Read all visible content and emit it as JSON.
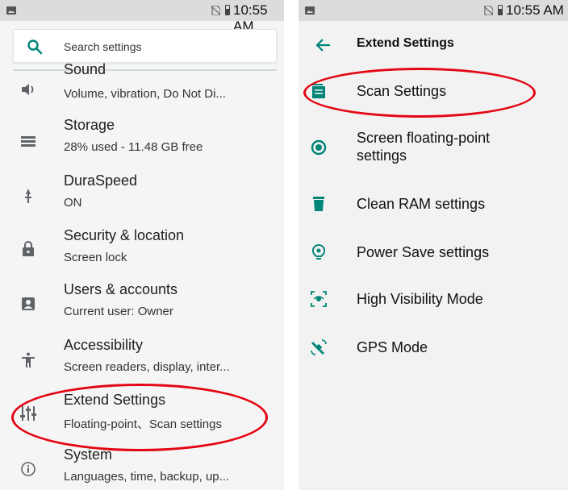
{
  "status_bar": {
    "time": "10:55 AM"
  },
  "left": {
    "search": {
      "placeholder": "Search settings"
    },
    "items": [
      {
        "title": "Sound",
        "subtitle": "Volume, vibration, Do Not Di...",
        "icon": "volume-icon"
      },
      {
        "title": "Storage",
        "subtitle": "28% used - 11.48 GB free",
        "icon": "storage-icon"
      },
      {
        "title": "DuraSpeed",
        "subtitle": "ON",
        "icon": "duraspeed-icon"
      },
      {
        "title": "Security & location",
        "subtitle": "Screen lock",
        "icon": "lock-icon"
      },
      {
        "title": "Users & accounts",
        "subtitle": "Current user: Owner",
        "icon": "account-icon"
      },
      {
        "title": "Accessibility",
        "subtitle": "Screen readers, display, inter...",
        "icon": "accessibility-icon"
      },
      {
        "title": "Extend Settings",
        "subtitle": "Floating-point、Scan settings",
        "icon": "tune-icon"
      },
      {
        "title": "System",
        "subtitle": "Languages, time, backup, up...",
        "icon": "info-icon"
      }
    ]
  },
  "right": {
    "title": "Extend Settings",
    "items": [
      {
        "label": "Scan Settings",
        "icon": "scan-icon"
      },
      {
        "label": "Screen floating-point settings",
        "icon": "floating-point-icon"
      },
      {
        "label": "Clean RAM settings",
        "icon": "trash-icon"
      },
      {
        "label": "Power Save settings",
        "icon": "power-save-icon"
      },
      {
        "label": "High Visibility Mode",
        "icon": "high-visibility-icon"
      },
      {
        "label": "GPS Mode",
        "icon": "gps-icon"
      }
    ]
  },
  "colors": {
    "accent": "#008577",
    "icon_gray": "#5f6368",
    "highlight": "#e30613",
    "status_bar": "#dcdcdc"
  }
}
